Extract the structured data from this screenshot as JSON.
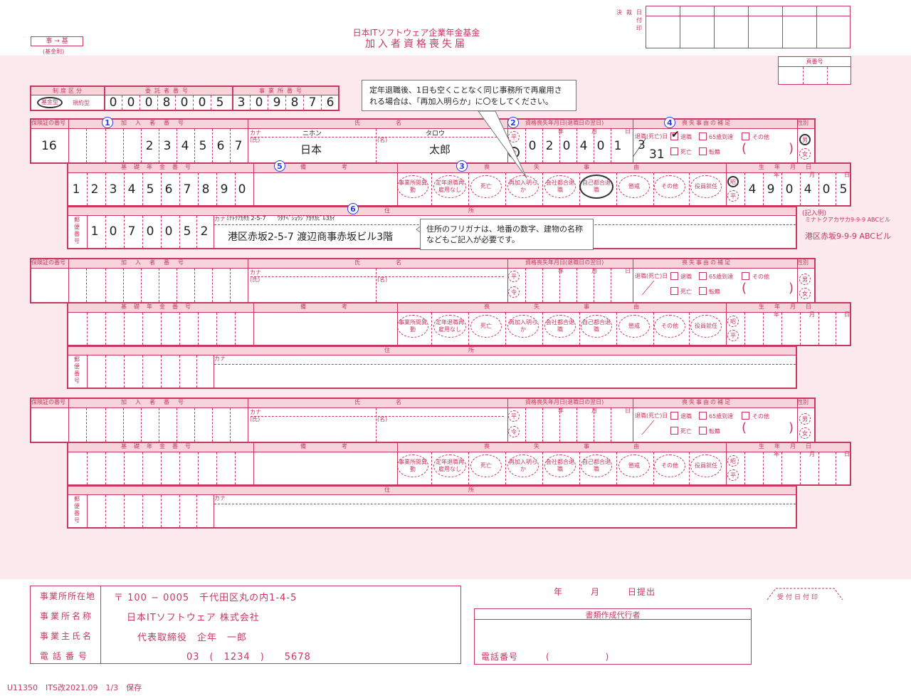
{
  "header": {
    "code_box": "事 → 基",
    "code_sub": "(基金則)",
    "org_name": "日本ITソフトウェア企業年金基金",
    "form_title": "加入者資格喪失届",
    "approval_labels": [
      "決",
      "裁",
      "日",
      "付",
      "印"
    ],
    "page_no_label": "頁番号"
  },
  "top_info": {
    "seido_label": "制度区分",
    "kikin_gata": "基金型",
    "kiyaku_gata": "規約型",
    "itaku_label": "委託者番号",
    "itaku_digits": [
      "0",
      "0",
      "0",
      "8",
      "0",
      "0",
      "5"
    ],
    "jigyosho_label": "事業所番号",
    "jigyosho_digits": [
      "3",
      "0",
      "9",
      "8",
      "7",
      "6"
    ]
  },
  "labels": {
    "hokensho": "保険証の番号",
    "kanyusha": "加入者番号",
    "shimei": "氏名",
    "kana": "カナ",
    "shi": "(氏)",
    "mei": "(名)",
    "shikaku_date": "資格喪失年月日(退職日の翌日)",
    "nen": "年",
    "tsuki": "月",
    "hi": "日",
    "hosoku": "喪失事由の補足",
    "taishoku_shibo_date": "退職(死亡)日",
    "seibetsu": "性別",
    "kiso_nenkin": "基礎年金番号",
    "biko": "備考",
    "soushitsu_jiyu": "喪失事由",
    "seinengappi": "生年月日",
    "jusho": "住所",
    "yubin": "郵便番号",
    "hei": "平",
    "rei": "令",
    "sho": "昭",
    "man": "男",
    "woman": "女",
    "chk_taishoku": "退職",
    "chk_65": "65歳到達",
    "chk_sonota": "その他",
    "chk_shibo": "死亡",
    "chk_tenseki": "転籍"
  },
  "reasons": [
    "事業所間異動",
    "定年退職再雇用なし",
    "死亡",
    "再加入明らか",
    "会社都合退職",
    "自己都合退職",
    "懲戒",
    "その他",
    "役員就任"
  ],
  "entry1": {
    "hokensho_no": "16",
    "kanyusha_digits": [
      "",
      "",
      "2",
      "3",
      "4",
      "5",
      "6",
      "7"
    ],
    "kana_shi": "ニホン",
    "kana_mei": "タロウ",
    "shi": "日本",
    "mei": "太郎",
    "loss_date_digits": [
      "0",
      "2",
      "0",
      "4",
      "0",
      "1"
    ],
    "taishoku_month": "3",
    "taishoku_day": "31",
    "kiso_digits": [
      "1",
      "2",
      "3",
      "4",
      "5",
      "6",
      "7",
      "8",
      "9",
      "0"
    ],
    "birth_digits": [
      "4",
      "9",
      "0",
      "4",
      "0",
      "5"
    ],
    "addr_kana": "ﾐﾅﾄｸｱｶｻｶ 2-5-7　　ﾜﾀﾅﾍﾞｼｮｳｼﾞｱｶｻｶﾋﾞﾙ3ｶｲ",
    "addr": "港区赤坂2-5-7  渡辺商事赤坂ビル3階",
    "zip_digits": [
      "1",
      "0",
      "7",
      "0",
      "0",
      "5",
      "2"
    ]
  },
  "annotations": {
    "n1": "1",
    "n2": "2",
    "n3": "3",
    "n4": "4",
    "n5": "5",
    "n6": "6",
    "callout_top": "定年退職後、1日も空くことなく同じ事務所で再雇用される場合は、「再加入明らか」に〇をしてください。",
    "callout_addr": "住所のフリガナは、地番の数字、建物の名称などもご記入が必要です。",
    "example_label": "(記入例)",
    "example_kana": "ミナトクアカサカ9-9-9 ABCビル",
    "example_addr": "港区赤坂9-9-9 ABCビル"
  },
  "footer": {
    "addr_label": "事業所所在地",
    "addr_value": "〒 100 − 0005　千代田区丸の内1-4-5",
    "name_label": "事業所名称",
    "name_value": "日本ITソフトウェア 株式会社",
    "owner_label": "事業主氏名",
    "owner_value": "代表取締役　企年　一郎",
    "tel_label": "電話番号",
    "tel_value": "03　(　1234　)　　5678",
    "submit": "年　　　月　　　日提出",
    "receipt": "受付日付印",
    "agent_label": "書類作成代行者",
    "agent_tel": "電話番号　　　(　　　　　　)",
    "form_code": "U11350　ITS改2021.09　1/3　保存"
  }
}
